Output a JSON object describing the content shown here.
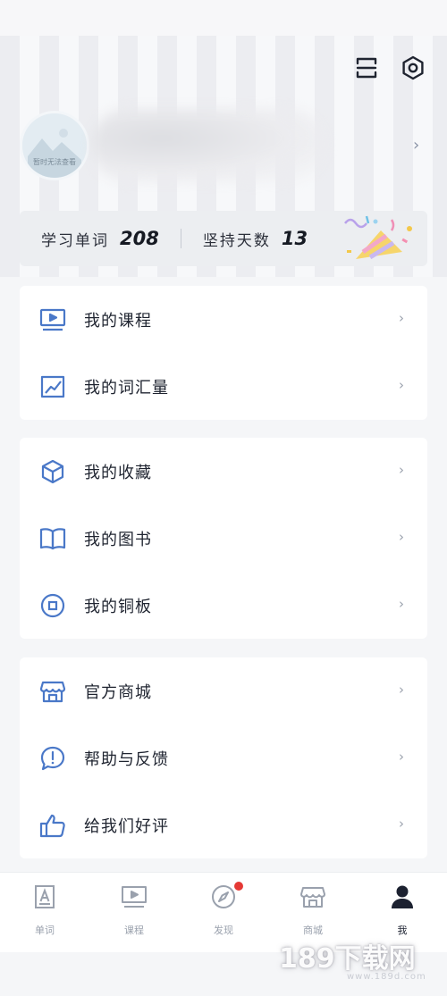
{
  "header": {
    "avatar_caption": "暂时无法查看"
  },
  "stats": {
    "words_label": "学习单词",
    "words_value": "208",
    "days_label": "坚持天数",
    "days_value": "13"
  },
  "menu_group_1": [
    {
      "label": "我的课程",
      "icon": "video-lesson-icon"
    },
    {
      "label": "我的词汇量",
      "icon": "trend-chart-icon"
    }
  ],
  "menu_group_2": [
    {
      "label": "我的收藏",
      "icon": "cube-icon"
    },
    {
      "label": "我的图书",
      "icon": "book-icon"
    },
    {
      "label": "我的铜板",
      "icon": "coin-icon"
    }
  ],
  "menu_group_3": [
    {
      "label": "官方商城",
      "icon": "store-icon"
    },
    {
      "label": "帮助与反馈",
      "icon": "feedback-icon"
    },
    {
      "label": "给我们好评",
      "icon": "thumbs-up-icon"
    }
  ],
  "tabbar": {
    "tabs": [
      {
        "label": "单词",
        "icon": "word-card-icon",
        "active": false
      },
      {
        "label": "课程",
        "icon": "video-lesson-icon",
        "active": false
      },
      {
        "label": "发现",
        "icon": "compass-icon",
        "active": false,
        "badge": true
      },
      {
        "label": "商城",
        "icon": "store-icon",
        "active": false
      },
      {
        "label": "我",
        "icon": "person-icon",
        "active": true
      }
    ]
  },
  "colors": {
    "accent_icon": "#4a78c8",
    "badge": "#e53935",
    "card": "#ffffff",
    "background": "#f5f6f8"
  },
  "watermark": {
    "main": "189下载网",
    "sub": "www.189d.com"
  }
}
